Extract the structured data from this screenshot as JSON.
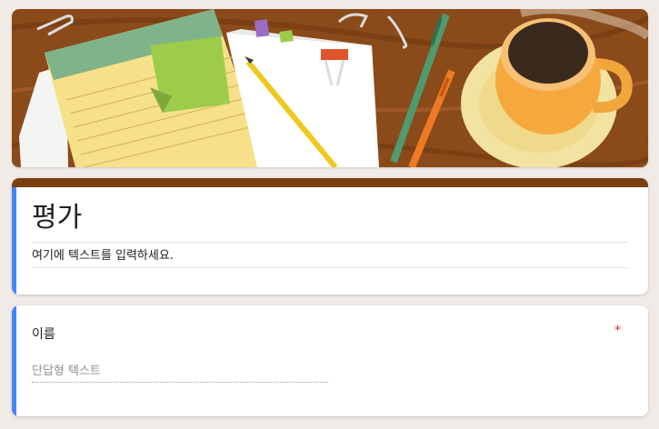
{
  "form": {
    "title": "평가",
    "description": "여기에 텍스트를 입력하세요."
  },
  "question": {
    "label": "이름",
    "required_mark": "*",
    "answer_placeholder": "단답형 텍스트"
  },
  "colors": {
    "theme_bar": "#7b3f0f",
    "accent": "#4285f4",
    "required": "#d93025",
    "background": "#f0ebe6"
  }
}
